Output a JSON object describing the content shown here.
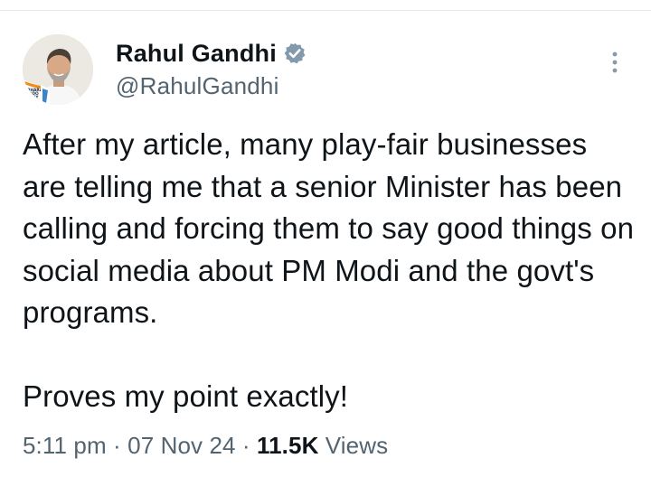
{
  "tweet": {
    "author": {
      "display_name": "Rahul Gandhi",
      "handle": "@RahulGandhi",
      "verified": true,
      "avatar_icon": "profile-photo",
      "avatar_badge_lines": [
        "BHARAT",
        "JODO",
        "NYAY",
        "YATRA"
      ]
    },
    "paragraphs": [
      "After my article, many play-fair businesses are telling me that a senior Minister has been calling and forcing them to say good things on social media about PM Modi and the govt's programs.",
      "Proves my point exactly!"
    ],
    "time": "5:11 pm",
    "separator": "·",
    "date": "07 Nov 24",
    "views_count": "11.5K",
    "views_label": "Views"
  },
  "colors": {
    "text": "#0f1419",
    "secondary": "#536471",
    "verified": "#829aab",
    "divider": "#e6e9ec"
  },
  "icons": {
    "verified": "verified-badge-icon",
    "more": "more-vertical-icon"
  }
}
